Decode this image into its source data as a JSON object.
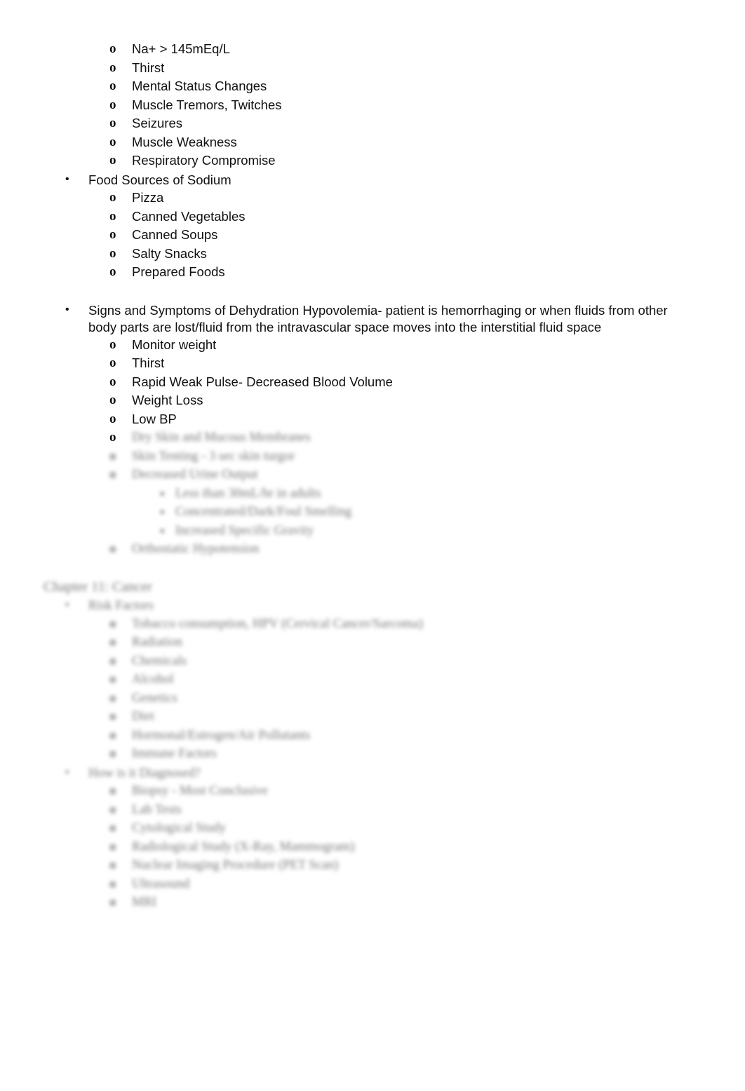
{
  "document": {
    "items": [
      {
        "level": 2,
        "text": "Na+ > 145mEq/L"
      },
      {
        "level": 2,
        "text": "Thirst"
      },
      {
        "level": 2,
        "text": "Mental Status Changes"
      },
      {
        "level": 2,
        "text": "Muscle Tremors, Twitches"
      },
      {
        "level": 2,
        "text": "Seizures"
      },
      {
        "level": 2,
        "text": "Muscle Weakness"
      },
      {
        "level": 2,
        "text": "Respiratory Compromise"
      },
      {
        "level": 1,
        "text": "Food Sources of Sodium"
      },
      {
        "level": 2,
        "text": "Pizza"
      },
      {
        "level": 2,
        "text": "Canned Vegetables"
      },
      {
        "level": 2,
        "text": "Canned Soups"
      },
      {
        "level": 2,
        "text": "Salty Snacks"
      },
      {
        "level": 2,
        "text": "Prepared Foods"
      },
      {
        "level": 1,
        "space_before": true,
        "text": "Signs and Symptoms of Dehydration Hypovolemia- patient is hemorrhaging or when fluids from other body parts are lost/fluid from the intravascular space moves into the interstitial fluid space"
      },
      {
        "level": 2,
        "text": "Monitor weight"
      },
      {
        "level": 2,
        "text": "Thirst"
      },
      {
        "level": 2,
        "text": "Rapid Weak Pulse- Decreased Blood Volume"
      },
      {
        "level": 2,
        "text": "Weight Loss"
      },
      {
        "level": 2,
        "text": "Low BP"
      },
      {
        "level": 2,
        "text": "Dry Skin and Mucous Membranes",
        "blurred": true,
        "bullet_clear": true
      },
      {
        "level": 2,
        "text": "Skin Tenting - 3 sec skin turgor",
        "blurred": true
      },
      {
        "level": 2,
        "text": "Decreased Urine Output",
        "blurred": true
      },
      {
        "level": 3,
        "text": "Less than 30mL/hr in adults",
        "blurred": true
      },
      {
        "level": 3,
        "text": "Concentrated/Dark/Foul Smelling",
        "blurred": true
      },
      {
        "level": 3,
        "text": "Increased Specific Gravity",
        "blurred": true
      },
      {
        "level": 2,
        "text": "Orthostatic Hypotension",
        "blurred": true
      },
      {
        "level": 0,
        "space_before": true,
        "text": "Chapter 11: Cancer",
        "blurred": true
      },
      {
        "level": 1,
        "text": "Risk Factors",
        "blurred": true
      },
      {
        "level": 2,
        "text": "Tobacco consumption, HPV (Cervical Cancer/Sarcoma)",
        "blurred": true
      },
      {
        "level": 2,
        "text": "Radiation",
        "blurred": true
      },
      {
        "level": 2,
        "text": "Chemicals",
        "blurred": true
      },
      {
        "level": 2,
        "text": "Alcohol",
        "blurred": true
      },
      {
        "level": 2,
        "text": "Genetics",
        "blurred": true
      },
      {
        "level": 2,
        "text": "Diet",
        "blurred": true
      },
      {
        "level": 2,
        "text": "Hormonal/Estrogen/Air Pollutants",
        "blurred": true
      },
      {
        "level": 2,
        "text": "Immune Factors",
        "blurred": true
      },
      {
        "level": 1,
        "text": "How is it Diagnosed?",
        "blurred": true
      },
      {
        "level": 2,
        "text": "Biopsy - Most Conclusive",
        "blurred": true
      },
      {
        "level": 2,
        "text": "Lab Tests",
        "blurred": true
      },
      {
        "level": 2,
        "text": "Cytological Study",
        "blurred": true
      },
      {
        "level": 2,
        "text": "Radiological Study (X-Ray, Mammogram)",
        "blurred": true
      },
      {
        "level": 2,
        "text": "Nuclear Imaging Procedure (PET Scan)",
        "blurred": true
      },
      {
        "level": 2,
        "text": "Ultrasound",
        "blurred": true
      },
      {
        "level": 2,
        "text": "MRI",
        "blurred": true
      }
    ],
    "bullet_glyphs": {
      "1": "•",
      "2": "o",
      "3": "▪"
    }
  }
}
